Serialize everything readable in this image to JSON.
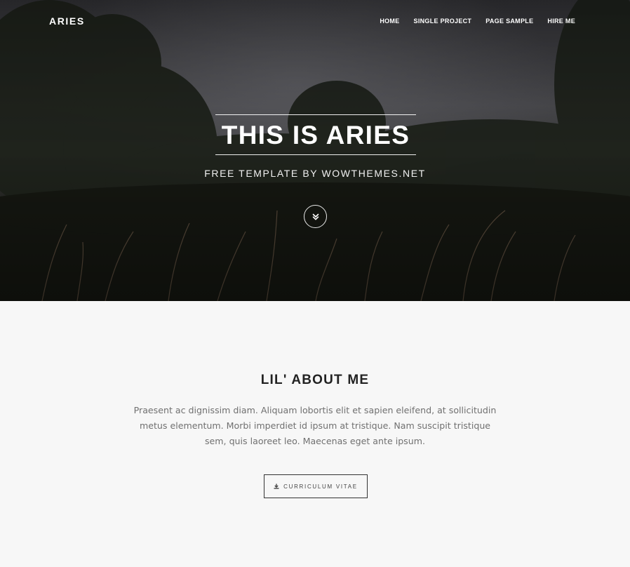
{
  "header": {
    "brand": "ARIES",
    "nav": [
      "HOME",
      "SINGLE PROJECT",
      "PAGE SAMPLE",
      "HIRE ME"
    ]
  },
  "hero": {
    "title": "THIS IS ARIES",
    "subtitle": "FREE TEMPLATE BY WOWTHEMES.NET",
    "scroll_icon": "double-chevron-down-icon"
  },
  "about": {
    "title": "LIL' ABOUT ME",
    "body": "Praesent ac dignissim diam. Aliquam lobortis elit et sapien eleifend, at sollicitudin metus elementum. Morbi imperdiet id ipsum at tristique. Nam suscipit tristique sem, quis laoreet leo. Maecenas eget ante ipsum.",
    "cv_button": {
      "label": "CURRICULUM VITAE",
      "icon": "download-icon"
    }
  },
  "colors": {
    "hero_overlay": "#2a2a2a",
    "about_background": "#f7f7f7",
    "heading": "#222222",
    "body_text": "#707070"
  }
}
